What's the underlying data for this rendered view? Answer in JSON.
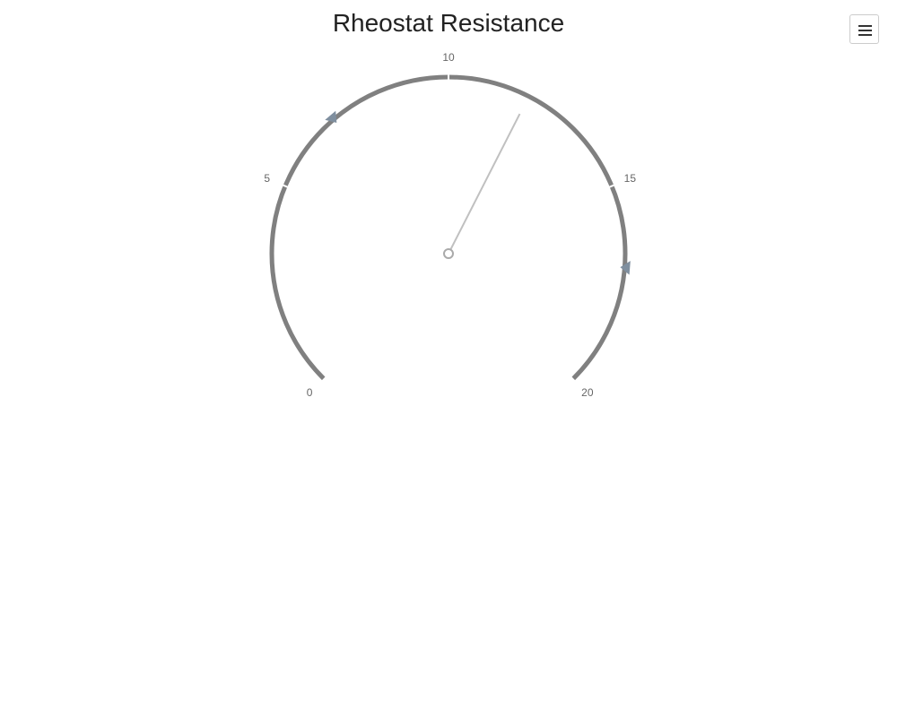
{
  "chart_data": {
    "type": "gauge",
    "title": "Rheostat Resistance",
    "min": 0,
    "max": 20,
    "value": 12,
    "ticks": [
      0,
      5,
      10,
      15,
      20
    ],
    "tick_labels": [
      "0",
      "5",
      "10",
      "15",
      "20"
    ],
    "markers": [
      {
        "name": "lower-marker",
        "value": 7
      },
      {
        "name": "upper-marker",
        "value": 17
      }
    ],
    "colors": {
      "arc": "#808080",
      "needle": "#c0c0c0",
      "marker": "#7f8f9f",
      "tick_label": "#666666"
    }
  },
  "toolbar": {
    "menu_icon": "hamburger-menu-icon"
  }
}
